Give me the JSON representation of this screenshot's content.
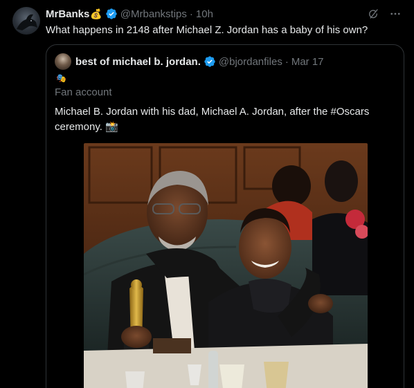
{
  "tweet": {
    "author_name": "MrBanks",
    "author_emoji": "💰",
    "handle": "@Mrbankstips",
    "separator": "·",
    "time": "10h",
    "text": "What happens in 2148 after Michael Z. Jordan has a baby of his own?"
  },
  "quoted_tweet": {
    "author_name": "best of michael b. jordan.",
    "handle": "@bjordanfiles",
    "separator": "·",
    "time": "Mar 17",
    "badge_emoji": "🎭",
    "label": "Fan account",
    "text": "Michael B. Jordan with his dad, Michael A. Jordan, after the #Oscars ceremony. 📸"
  },
  "icons": {
    "verified": "verified-badge-icon",
    "grok": "grok-icon",
    "more": "more-icon"
  },
  "colors": {
    "background": "#000000",
    "text": "#e7e9ea",
    "muted": "#71767b",
    "verified": "#1d9bf0",
    "border": "#2f3336"
  }
}
